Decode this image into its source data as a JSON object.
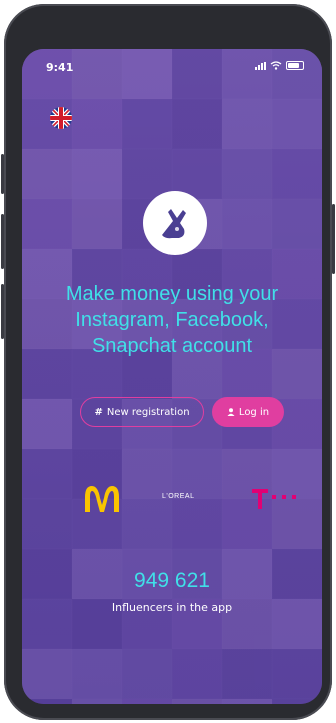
{
  "status_bar": {
    "time": "9:41"
  },
  "language": {
    "flag_icon": "uk-flag-icon"
  },
  "logo": {
    "icon": "rock-hand-icon"
  },
  "headline": {
    "lines": [
      "Make money using your",
      "Instagram, Facebook,",
      "Snapchat account"
    ]
  },
  "buttons": {
    "register_icon": "#",
    "register_label": "New registration",
    "login_icon": "person-icon",
    "login_label": "Log in"
  },
  "brands": {
    "mcdonalds": "mcdonalds-logo",
    "loreal_label": "L'OREAL",
    "telekom": "telekom-logo"
  },
  "stats": {
    "count": "949 621",
    "label": "Influencers in the app"
  },
  "colors": {
    "accent_cyan": "#40e0e8",
    "accent_pink": "#e03ea0",
    "background_purple": "#6b45ad"
  }
}
